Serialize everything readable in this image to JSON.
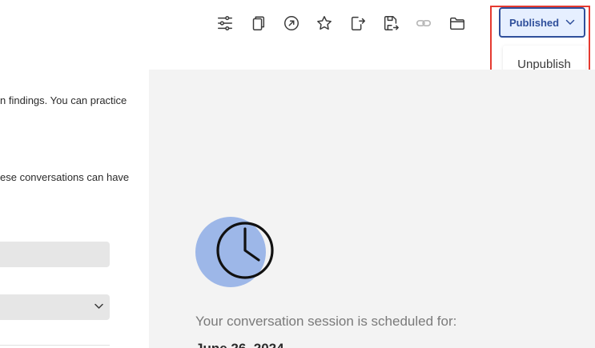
{
  "toolbar": {
    "icons": [
      "sliders-icon",
      "copy-icon",
      "compass-icon",
      "star-icon",
      "share-icon",
      "save-as-icon",
      "link-icon",
      "folder-icon"
    ],
    "status_button_label": "Published",
    "dropdown_items": [
      "Unpublish"
    ]
  },
  "left": {
    "line1": "n findings. You can practice",
    "line2": "ese conversations can have"
  },
  "main": {
    "scheduled_label": "Your conversation session is scheduled for:",
    "scheduled_date": "June 26, 2024"
  },
  "colors": {
    "accent": "#2f4f9b",
    "accent_bg": "#e6efff",
    "highlight": "#e53a30",
    "clock_fill": "#9db7e8"
  }
}
